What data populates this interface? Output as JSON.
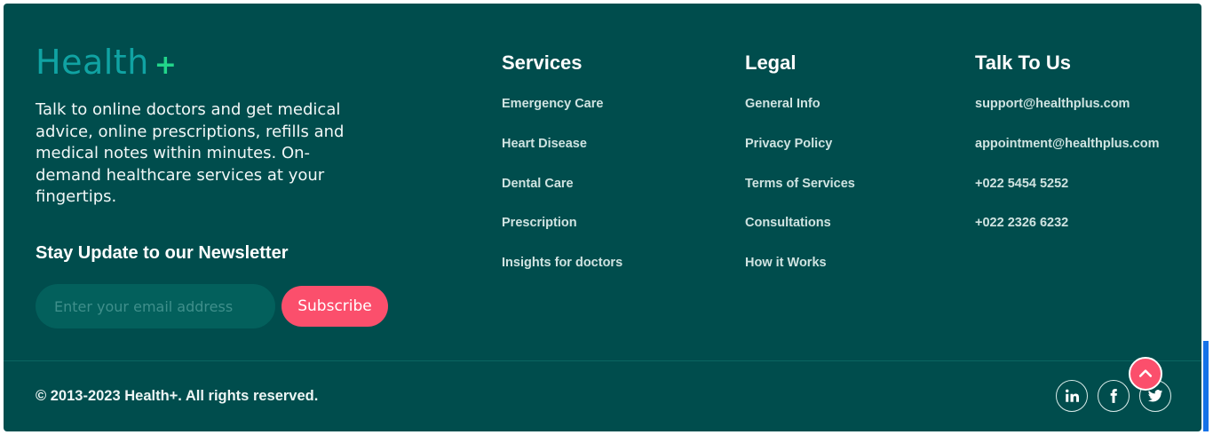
{
  "brand": {
    "name": "Health",
    "plus": "+"
  },
  "about": "Talk to online doctors and get medical advice, online prescriptions, refills and medical notes within minutes. On-demand healthcare services at your fingertips.",
  "newsletter": {
    "title": "Stay Update to our Newsletter",
    "placeholder": "Enter your email address",
    "value": "",
    "button": "Subscribe"
  },
  "columns": {
    "services": {
      "title": "Services",
      "items": [
        "Emergency Care",
        "Heart Disease",
        "Dental Care",
        "Prescription",
        "Insights for doctors"
      ]
    },
    "legal": {
      "title": "Legal",
      "items": [
        "General Info",
        "Privacy Policy",
        "Terms of Services",
        "Consultations",
        "How it Works"
      ]
    },
    "talk": {
      "title": "Talk To Us",
      "items": [
        "support@healthplus.com",
        "appointment@healthplus.com",
        "+022 5454 5252",
        "+022 2326 6232"
      ]
    }
  },
  "copyright": "© 2013-2023 Health+. All rights reserved.",
  "social": {
    "icons": [
      "linkedin-icon",
      "facebook-icon",
      "twitter-icon"
    ]
  },
  "scroll_top": {
    "icon": "chevron-up-icon"
  },
  "colors": {
    "background": "#004d4d",
    "brand": "#10a3a3",
    "accent_plus": "#22d58a",
    "button": "#fb4f6c"
  }
}
